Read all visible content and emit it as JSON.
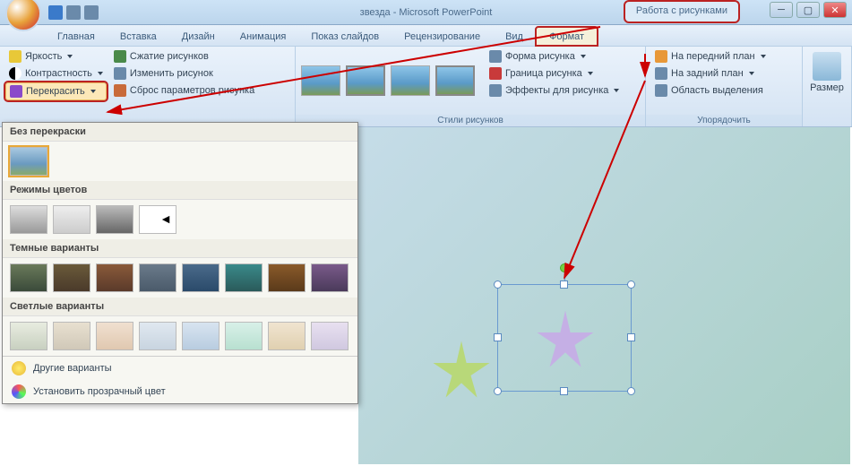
{
  "title": "звезда - Microsoft PowerPoint",
  "context_tab": "Работа с рисунками",
  "tabs": [
    "Главная",
    "Вставка",
    "Дизайн",
    "Анимация",
    "Показ слайдов",
    "Рецензирование",
    "Вид",
    "Формат"
  ],
  "ribbon": {
    "adjust": {
      "brightness": "Яркость",
      "contrast": "Контрастность",
      "recolor": "Перекрасить",
      "compress": "Сжатие рисунков",
      "change": "Изменить рисунок",
      "reset": "Сброс параметров рисунка"
    },
    "styles": {
      "shape": "Форма рисунка",
      "border": "Граница рисунка",
      "effects": "Эффекты для рисунка",
      "label": "Стили рисунков"
    },
    "arrange": {
      "front": "На передний план",
      "back": "На задний план",
      "select_pane": "Область выделения",
      "label": "Упорядочить"
    },
    "size": {
      "label": "Размер"
    }
  },
  "gallery": {
    "no_recolor": "Без перекраски",
    "color_modes": "Режимы цветов",
    "dark": "Темные варианты",
    "light": "Светлые варианты",
    "more": "Другие варианты",
    "transparent": "Установить прозрачный цвет"
  }
}
